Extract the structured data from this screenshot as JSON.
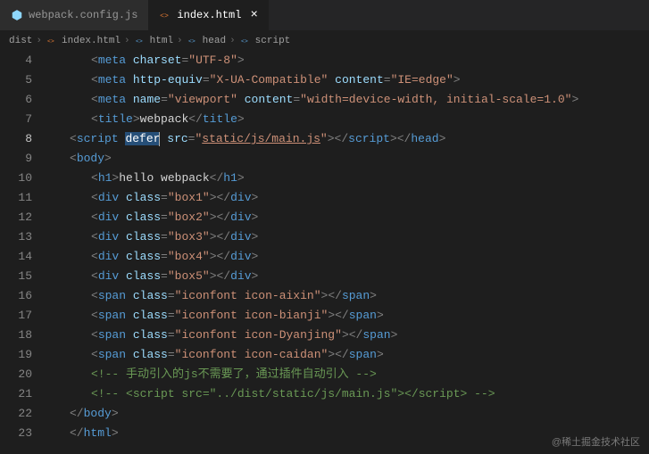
{
  "tabs": [
    {
      "label": "webpack.config.js",
      "active": false,
      "icon": "webpack-icon",
      "iconColor": "#8ed6fb"
    },
    {
      "label": "index.html",
      "active": true,
      "icon": "html-icon",
      "iconColor": "#e37933"
    }
  ],
  "breadcrumbs": {
    "items": [
      "dist",
      "index.html",
      "html",
      "head",
      "script"
    ]
  },
  "lineStart": 4,
  "lineEnd": 23,
  "currentLine": 8,
  "code": {
    "l4": {
      "tag": "meta",
      "attrs": [
        [
          "charset",
          "UTF-8"
        ]
      ]
    },
    "l5": {
      "tag": "meta",
      "attrs": [
        [
          "http-equiv",
          "X-UA-Compatible"
        ],
        [
          "content",
          "IE=edge"
        ]
      ]
    },
    "l6": {
      "tag": "meta",
      "attrs": [
        [
          "name",
          "viewport"
        ],
        [
          "content",
          "width=device-width, initial-scale=1.0"
        ]
      ]
    },
    "l7": {
      "tag": "title",
      "text": "webpack"
    },
    "l8": {
      "tag": "script",
      "defer": "defer",
      "src": "static/js/main.js",
      "closeHead": "head"
    },
    "l9": {
      "tag": "body"
    },
    "l10": {
      "tag": "h1",
      "text": "hello webpack"
    },
    "l11": {
      "tag": "div",
      "cls": "box1"
    },
    "l12": {
      "tag": "div",
      "cls": "box2"
    },
    "l13": {
      "tag": "div",
      "cls": "box3"
    },
    "l14": {
      "tag": "div",
      "cls": "box4"
    },
    "l15": {
      "tag": "div",
      "cls": "box5"
    },
    "l16": {
      "tag": "span",
      "cls": "iconfont icon-aixin"
    },
    "l17": {
      "tag": "span",
      "cls": "iconfont icon-bianji"
    },
    "l18": {
      "tag": "span",
      "cls": "iconfont icon-Dyanjing"
    },
    "l19": {
      "tag": "span",
      "cls": "iconfont icon-caidan"
    },
    "l20": {
      "comment": "手动引入的js不需要了，通过插件自动引入"
    },
    "l21": {
      "comment_open": "<script src=\"../dist/static/js/main.js\">",
      "comment_close_tag": "script"
    },
    "l22": {
      "closeTag": "body"
    },
    "l23": {
      "closeTag": "html"
    }
  },
  "watermark": "@稀土掘金技术社区"
}
